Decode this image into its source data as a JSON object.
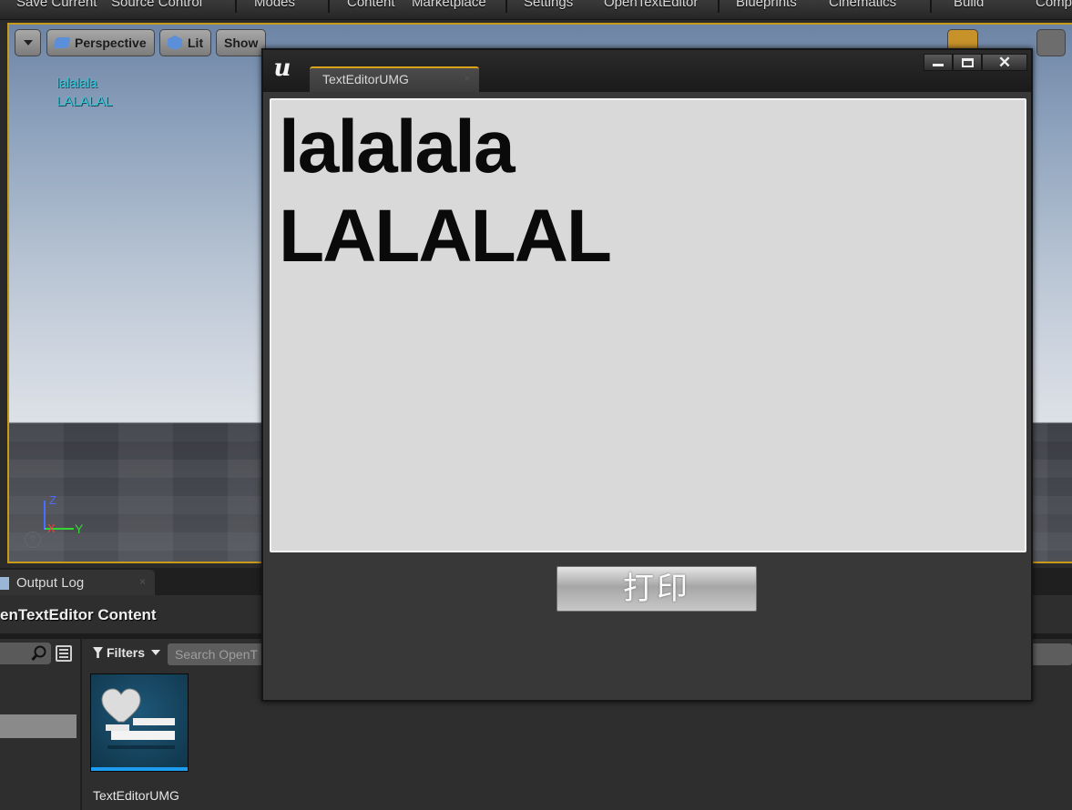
{
  "menu": {
    "items": [
      "Save Current",
      "Source Control",
      "Modes",
      "Content",
      "Marketplace",
      "Settings",
      "OpenTextEditor",
      "Blueprints",
      "Cinematics",
      "Build",
      "Comp"
    ]
  },
  "viewport": {
    "options_icon": "chevron-down-icon",
    "perspective_label": "Perspective",
    "lit_label": "Lit",
    "show_label": "Show",
    "text_lines": [
      "lalalala",
      "LALALAL"
    ],
    "axis": {
      "z": "Z",
      "x": "X",
      "y": "Y"
    },
    "help_icon": "?"
  },
  "output_log": {
    "tab_label": "Output Log",
    "close": "×"
  },
  "content_browser": {
    "title": "enTextEditor Content",
    "filters_label": "Filters",
    "search_placeholder": "Search OpenT",
    "asset_label": "TextEditorUMG",
    "accent_color": "#1d9cf0"
  },
  "window": {
    "tab_label": "TextEditorUMG",
    "tab_close": "×",
    "minimize_icon": "minimize-icon",
    "maximize_icon": "maximize-icon",
    "close_glyph": "✕",
    "editor_lines": [
      "lalalala",
      "LALALAL"
    ],
    "print_button": "打印",
    "tab_accent": "#d9a21a"
  }
}
